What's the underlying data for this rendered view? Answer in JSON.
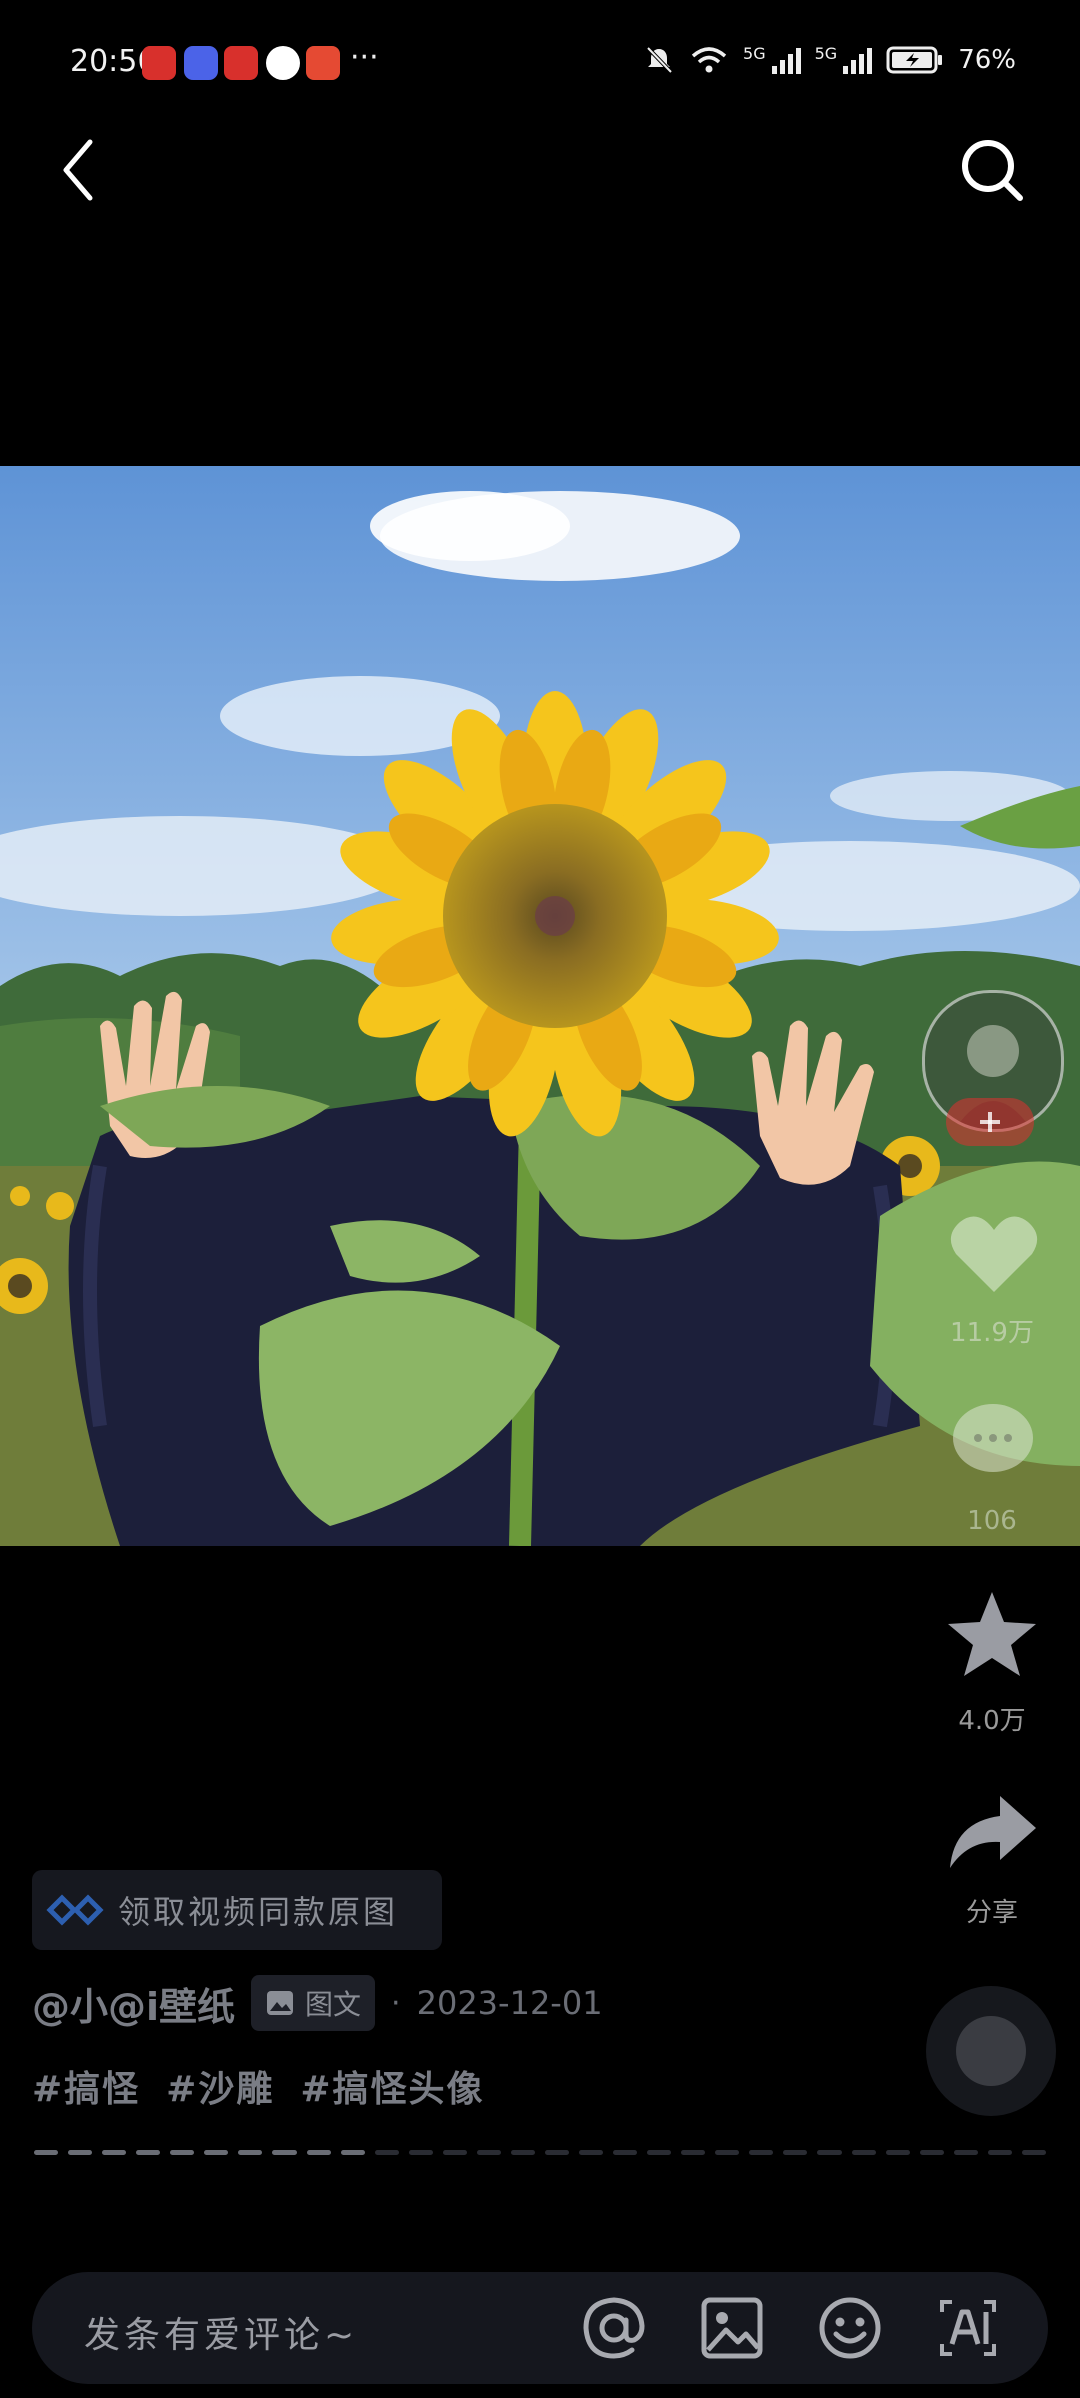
{
  "status_bar": {
    "time": "20:56",
    "more": "···",
    "battery": "76%",
    "network_1": "5G",
    "network_2": "5G"
  },
  "colors": {
    "background": "#000000",
    "accent_red": "#e0322f"
  },
  "post": {
    "claim_banner": "领取视频同款原图",
    "author": "@小@i壁纸",
    "type_label": "图文",
    "date_sep": "·",
    "date": "2023-12-01",
    "tags": [
      "#搞怪",
      "#沙雕",
      "#搞怪头像"
    ]
  },
  "rail": {
    "likes": "11.9万",
    "comments": "106",
    "favorites": "4.0万",
    "share": "分享"
  },
  "comment_bar": {
    "placeholder": "发条有爱评论~"
  },
  "progress": {
    "total_segments": 30,
    "active_segments": 10
  }
}
